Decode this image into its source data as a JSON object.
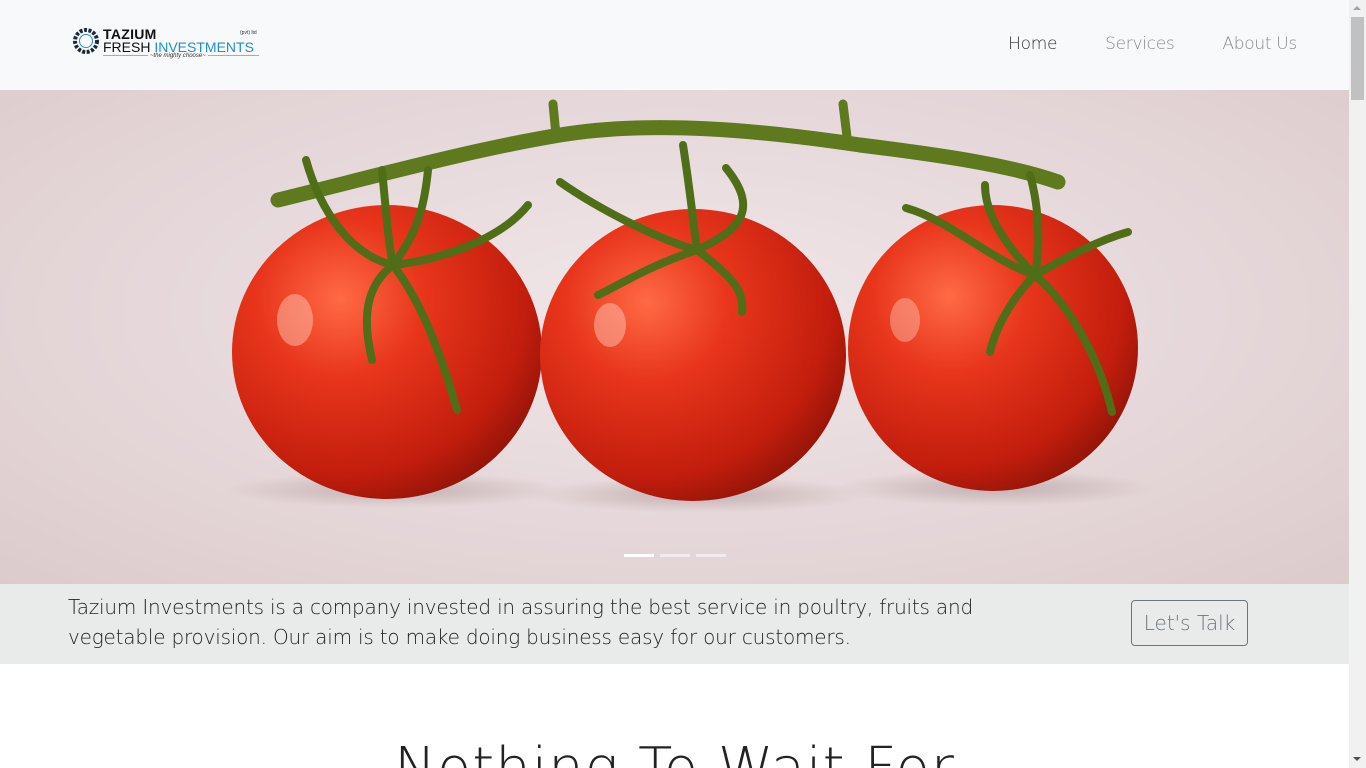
{
  "brand": {
    "line1": "TAZIUM",
    "small": "(pvt) ltd",
    "fresh": "FRESH",
    "investments": "INVESTMENTS",
    "tagline": "~the mighty choose~"
  },
  "nav": {
    "items": [
      {
        "label": "Home",
        "active": true
      },
      {
        "label": "Services",
        "active": false
      },
      {
        "label": "About Us",
        "active": false
      }
    ]
  },
  "hero": {
    "image": "tomatoes-on-vine",
    "slide_count": 3,
    "active_slide": 1
  },
  "banner": {
    "text": "Tazium Investments is a company invested in assuring the best service in poultry, fruits and vegetable provision. Our aim is to make doing business easy for our customers.",
    "button_label": "Let's Talk"
  },
  "section": {
    "title": "Nothing To Wait For"
  },
  "colors": {
    "navbar_bg": "#f8f9fa",
    "banner_bg": "#e9ebea",
    "brand_blue": "#1f8fc7",
    "tomato_red": "#d62a14"
  }
}
